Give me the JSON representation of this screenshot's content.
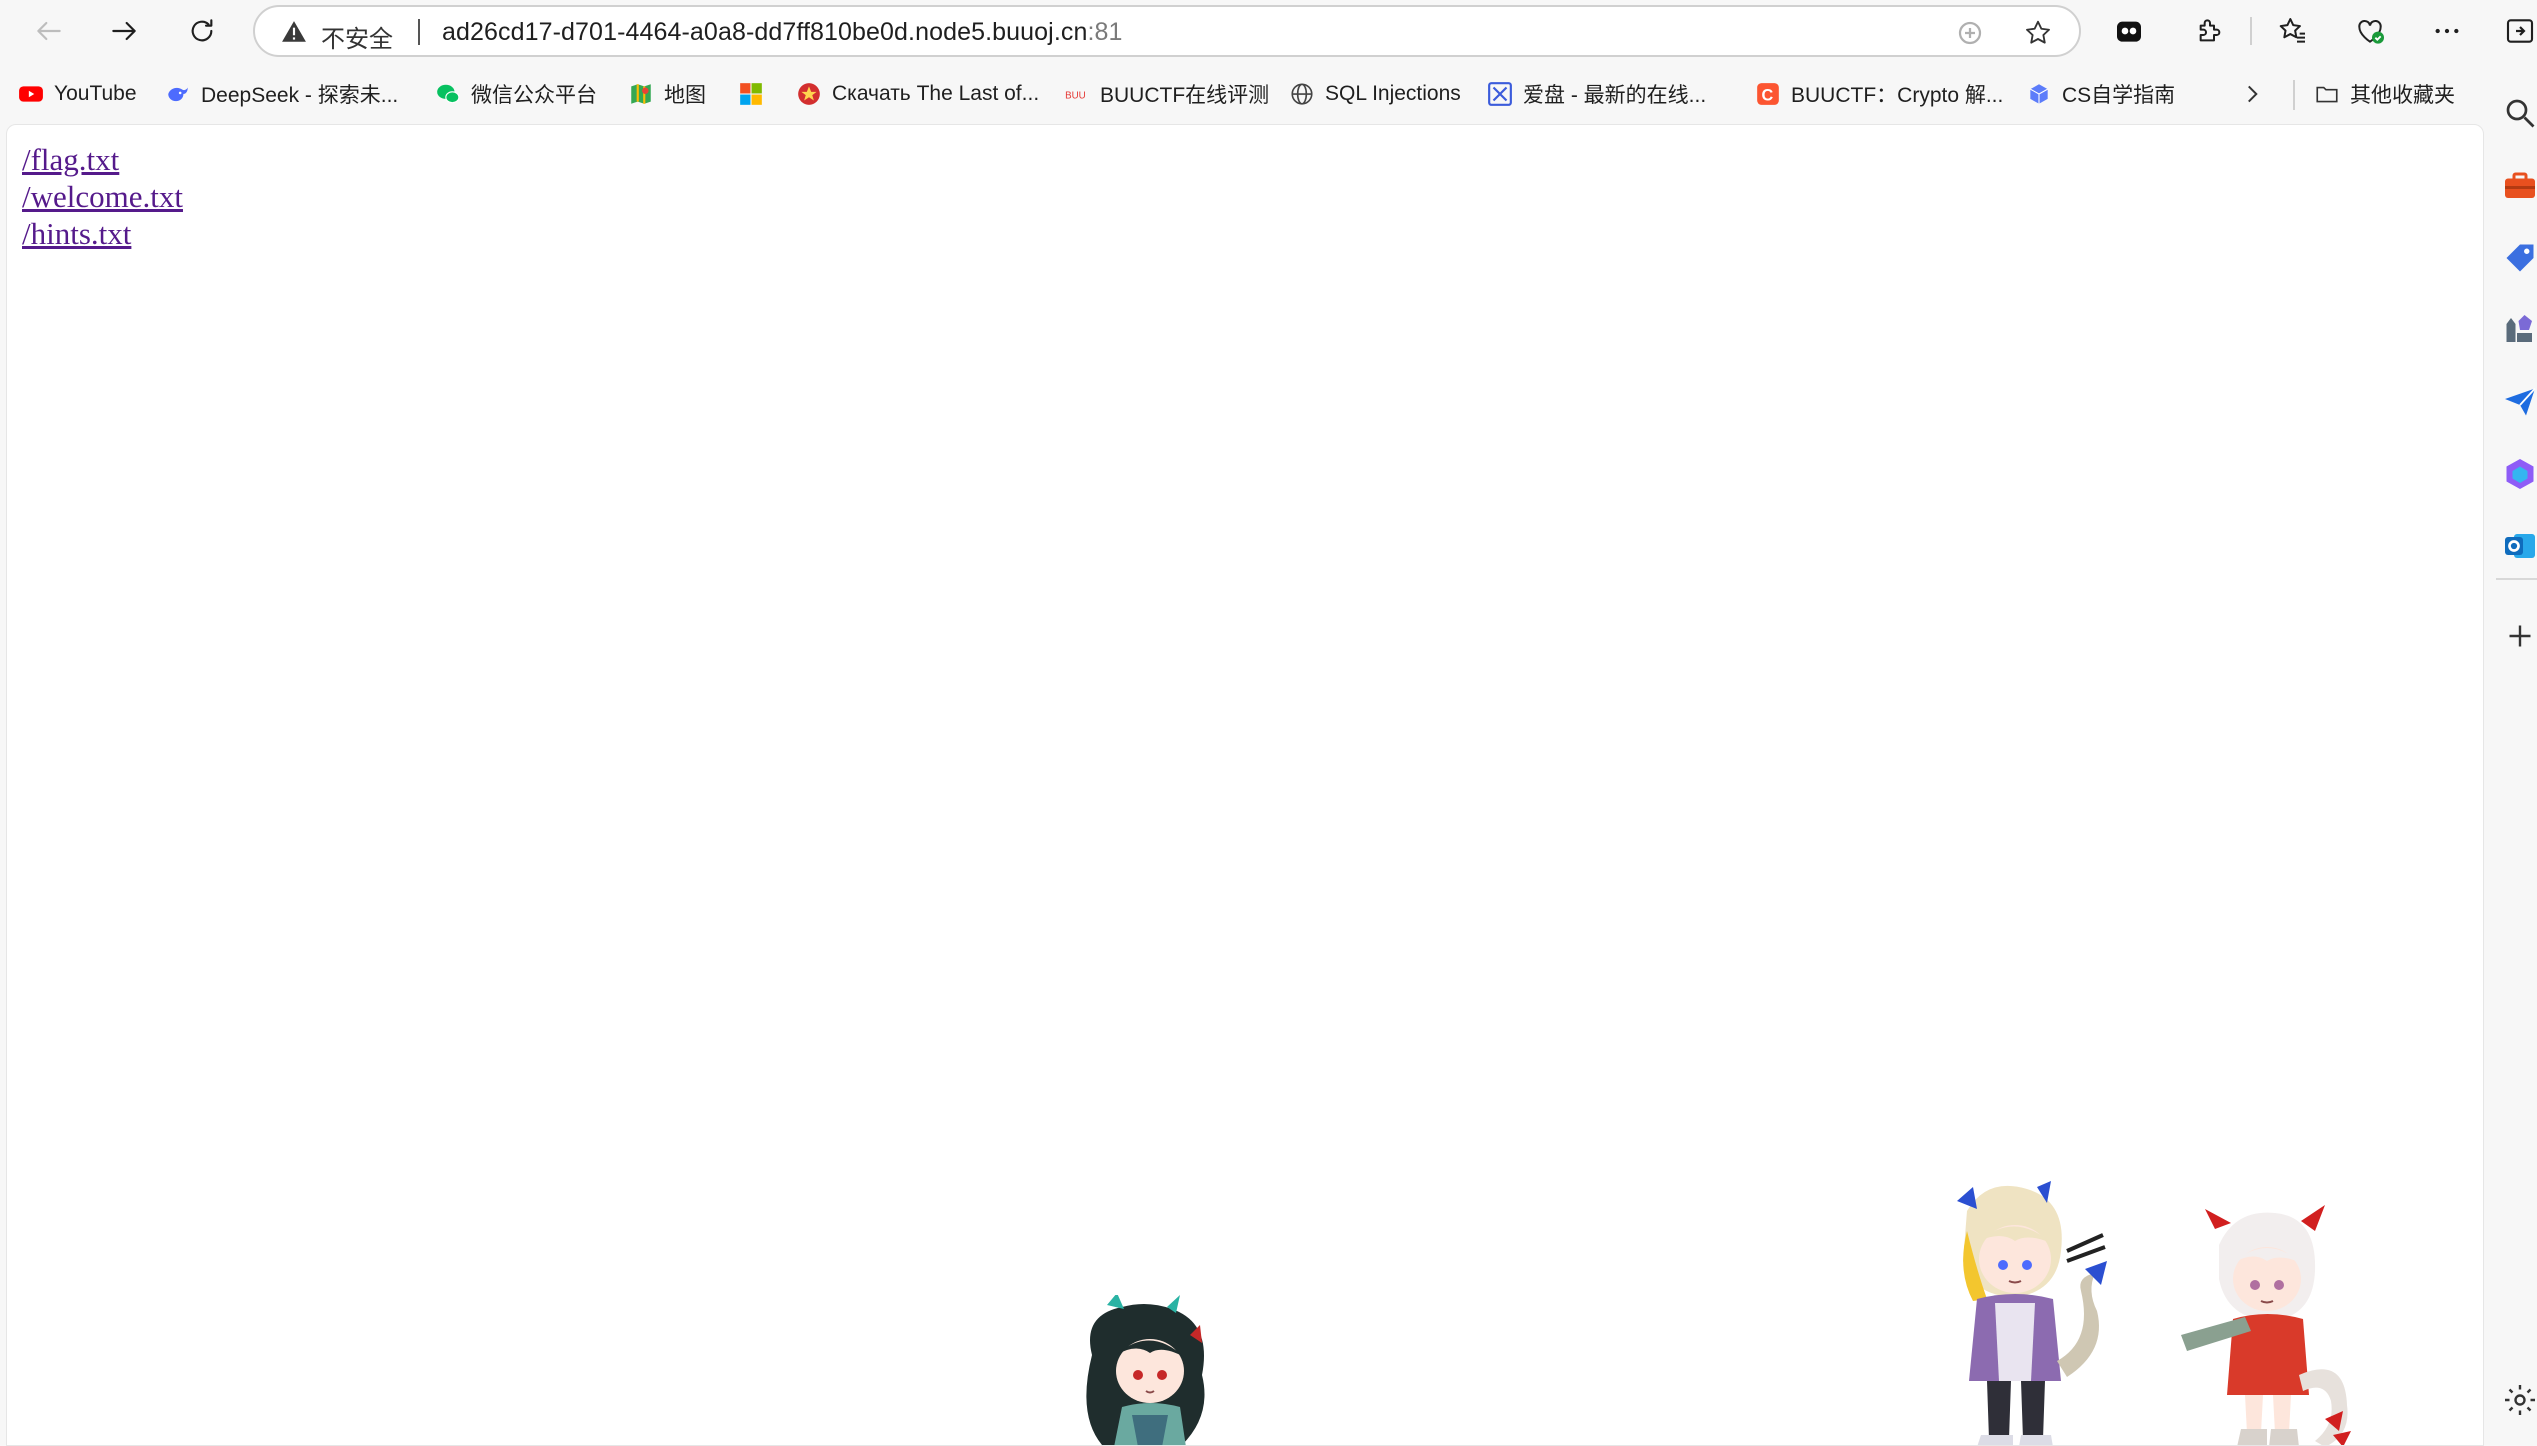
{
  "toolbar": {
    "back_icon": "arrow-left-icon",
    "forward_icon": "arrow-right-icon",
    "reload_icon": "reload-icon",
    "security_label": "不安全",
    "url_host": "ad26cd17-d701-4464-a0a8-dd7ff810be0d.node5.buuoj.cn",
    "url_port": ":81",
    "icons": [
      "translate-icon",
      "star-icon",
      "extension-ghost-icon",
      "puzzle-icon",
      "favorites-icon",
      "browser-essentials-icon",
      "more-icon",
      "sidebar-toggle-icon"
    ]
  },
  "bookmarks": [
    {
      "label": "YouTube",
      "icon": "youtube-icon",
      "color": "#ff0000"
    },
    {
      "label": "DeepSeek - 探索未...",
      "icon": "deepseek-icon",
      "color": "#4d6bfe"
    },
    {
      "label": "微信公众平台",
      "icon": "wechat-icon",
      "color": "#07c160"
    },
    {
      "label": "地图",
      "icon": "maps-icon",
      "color": "#34a853"
    },
    {
      "label": "",
      "icon": "microsoft-icon",
      "color": "#f25022"
    },
    {
      "label": "Скачать The Last of...",
      "icon": "game-site-icon",
      "color": "#d32f2f"
    },
    {
      "label": "BUUCTF在线评测",
      "icon": "buuctf-icon",
      "color": "#e53935"
    },
    {
      "label": "SQL Injections",
      "icon": "globe-icon",
      "color": "#444444"
    },
    {
      "label": "爱盘 - 最新的在线...",
      "icon": "aipan-icon",
      "color": "#3b5bdb"
    },
    {
      "label": "BUUCTF：Crypto 解...",
      "icon": "csdn-icon",
      "color": "#fc5531"
    },
    {
      "label": "CS自学指南",
      "icon": "cube-icon",
      "color": "#5c7cfa"
    }
  ],
  "bookmarks_more_icon": "chevron-right-icon",
  "other_bookmarks": {
    "label": "其他收藏夹",
    "icon": "folder-icon"
  },
  "page": {
    "links": [
      "/flag.txt",
      "/welcome.txt",
      "/hints.txt"
    ],
    "link_color": "#551a8b"
  },
  "sidebar": {
    "icons": [
      "search-icon",
      "toolbox-icon",
      "tag-icon",
      "games-icon",
      "send-icon",
      "copilot-icon",
      "outlook-icon",
      "add-icon",
      "settings-icon"
    ]
  },
  "colors": {
    "chrome_bg": "#f7f7f7",
    "page_bg": "#ffffff"
  }
}
